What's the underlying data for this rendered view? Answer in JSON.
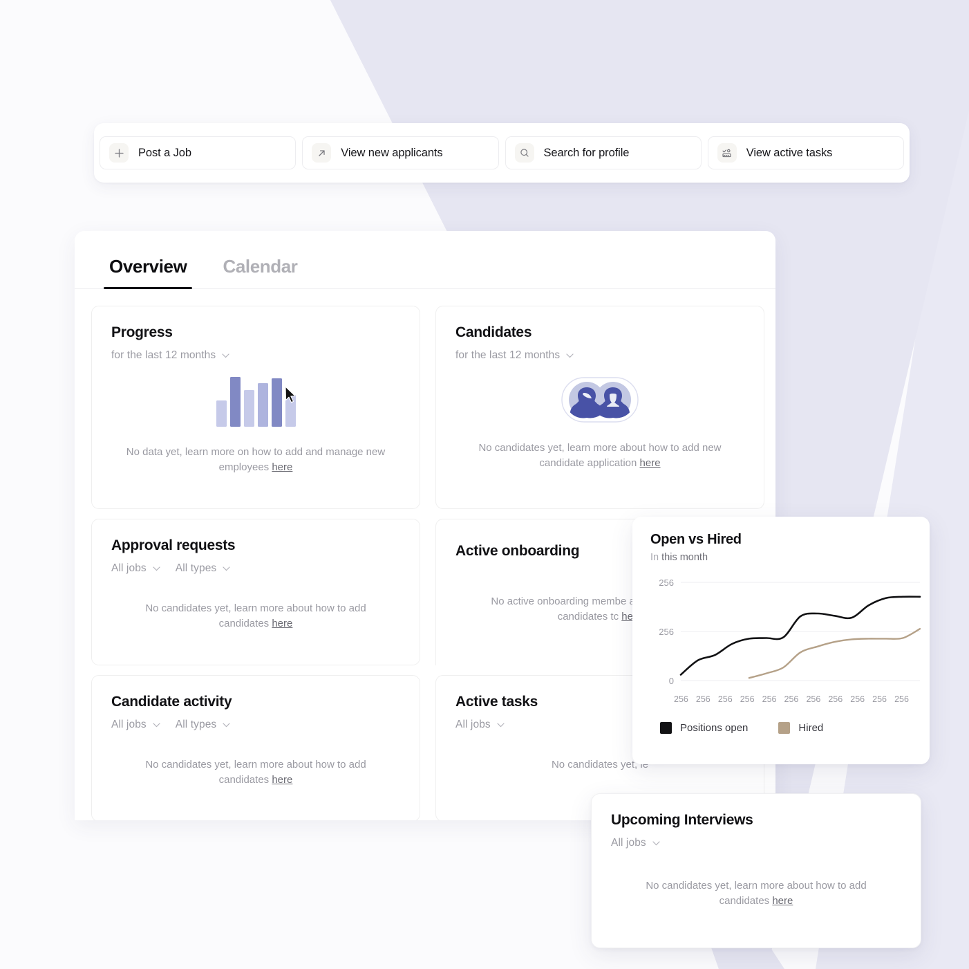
{
  "quick_actions": {
    "items": [
      {
        "label": "Post a Job",
        "icon": "plus-icon"
      },
      {
        "label": "View new applicants",
        "icon": "arrow-up-right-icon"
      },
      {
        "label": "Search for profile",
        "icon": "search-icon"
      },
      {
        "label": "View active tasks",
        "icon": "tasks-icon"
      }
    ]
  },
  "tabs": [
    {
      "label": "Overview",
      "active": true
    },
    {
      "label": "Calendar",
      "active": false
    }
  ],
  "cards": {
    "progress": {
      "title": "Progress",
      "range": "for the last 12 months",
      "empty_text": "No data yet, learn more on how to add and manage new employees ",
      "empty_link": "here"
    },
    "candidates": {
      "title": "Candidates",
      "range": "for the last 12 months",
      "empty_text": "No candidates yet, learn more about how to add new candidate application ",
      "empty_link": "here"
    },
    "approval_requests": {
      "title": "Approval requests",
      "filter_jobs": "All jobs",
      "filter_types": "All types",
      "empty_text": "No candidates yet, learn more about how to add candidates ",
      "empty_link": "here"
    },
    "active_onboarding": {
      "title": "Active onboarding",
      "empty_text": "No active onboarding membe about how to add candidates tc ",
      "empty_link": "here"
    },
    "candidate_activity": {
      "title": "Candidate activity",
      "filter_jobs": "All jobs",
      "filter_types": "All types",
      "empty_text": "No candidates yet, learn more about how to add candidates ",
      "empty_link": "here"
    },
    "active_tasks": {
      "title": "Active tasks",
      "filter_jobs": "All jobs",
      "empty_text": "No candidates yet, le"
    },
    "upcoming_interviews": {
      "title": "Upcoming Interviews",
      "filter_jobs": "All jobs",
      "empty_text": "No candidates yet, learn more about how to add candidates ",
      "empty_link": "here"
    }
  },
  "chart_data": {
    "type": "line",
    "title": "Open vs Hired",
    "subtitle_prefix": "In",
    "subtitle_value": "this month",
    "xlabel": "",
    "ylabel": "",
    "grid": true,
    "legend_position": "bottom-left",
    "ytick_labels": [
      "256",
      "256",
      "0"
    ],
    "ylim": [
      0,
      300
    ],
    "xtick_labels": [
      "256",
      "256",
      "256",
      "256",
      "256",
      "256",
      "256",
      "256",
      "256",
      "256",
      "256"
    ],
    "series": [
      {
        "name": "Positions open",
        "color": "#121214",
        "values": [
          18,
          62,
          78,
          112,
          128,
          130,
          132,
          196,
          205,
          198,
          192,
          230,
          252,
          256,
          256
        ]
      },
      {
        "name": "Hired",
        "color": "#b5a188",
        "values": [
          null,
          null,
          null,
          null,
          8,
          22,
          40,
          86,
          104,
          118,
          126,
          128,
          128,
          130,
          158
        ]
      }
    ]
  },
  "illustrations": {
    "progress_bars": {
      "heights": [
        38,
        72,
        53,
        63,
        70,
        46
      ],
      "colors": [
        "#c6cae9",
        "#8189c4",
        "#c6cae9",
        "#aeb4de",
        "#8189c4",
        "#c6cae9"
      ]
    },
    "candidates_avatar": {
      "circle_color": "#c3c8e3",
      "figure_color": "#4852a6",
      "outline_color": "#d9dcee"
    }
  },
  "colors": {
    "page_bg": "#fbfbfd",
    "decor": "#e6e6f2",
    "accent_dark": "#121214",
    "accent_tan": "#b5a188",
    "text_primary": "#111114",
    "text_muted": "#9a9aa2"
  }
}
